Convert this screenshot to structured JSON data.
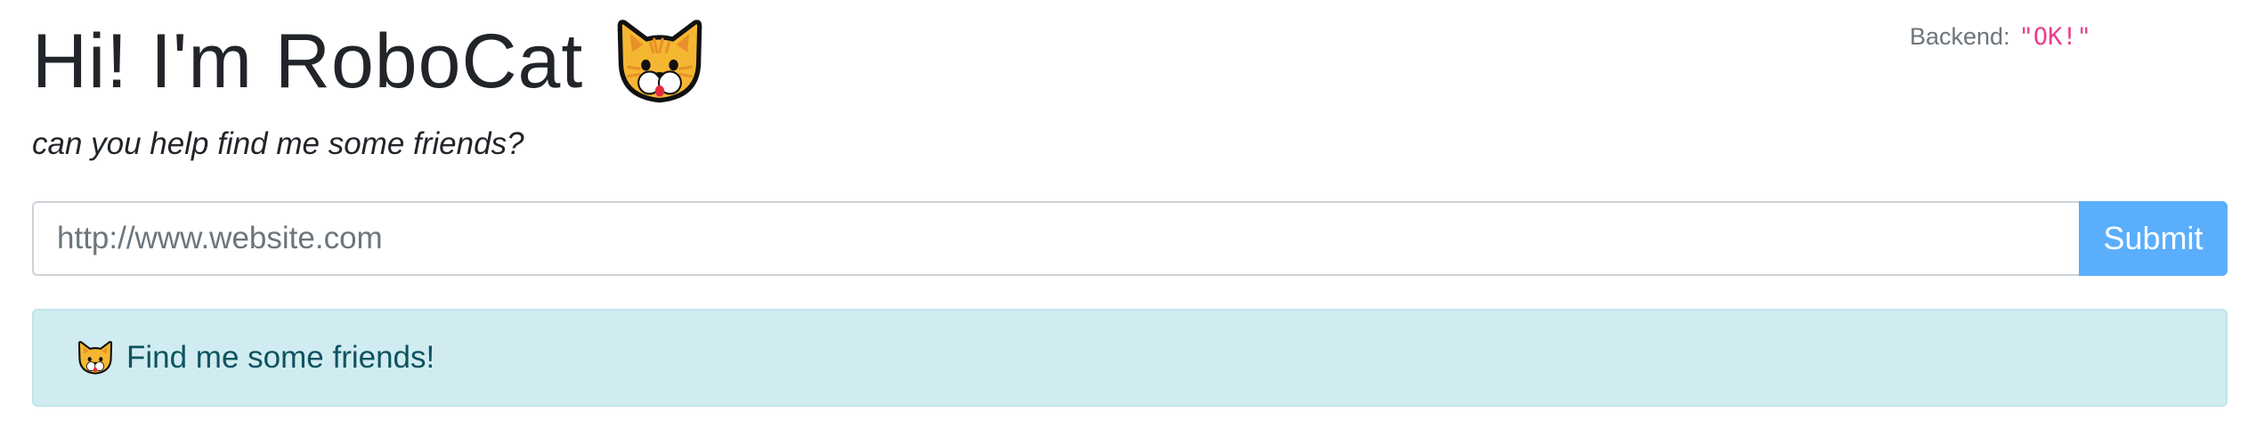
{
  "header": {
    "title": "Hi! I'm RoboCat",
    "title_icon": "cat-face-icon",
    "subtitle": "can you help find me some friends?"
  },
  "backend": {
    "label": "Backend:",
    "value": "\"OK!\""
  },
  "form": {
    "url_placeholder": "http://www.website.com",
    "url_value": "",
    "submit_label": "Submit"
  },
  "alert": {
    "icon": "cat-face-icon",
    "text": "Find me some friends!"
  },
  "colors": {
    "submit_bg": "#5aaefc",
    "alert_bg": "#d1ecf1",
    "alert_text": "#0c5460",
    "backend_value": "#e83e8c"
  }
}
